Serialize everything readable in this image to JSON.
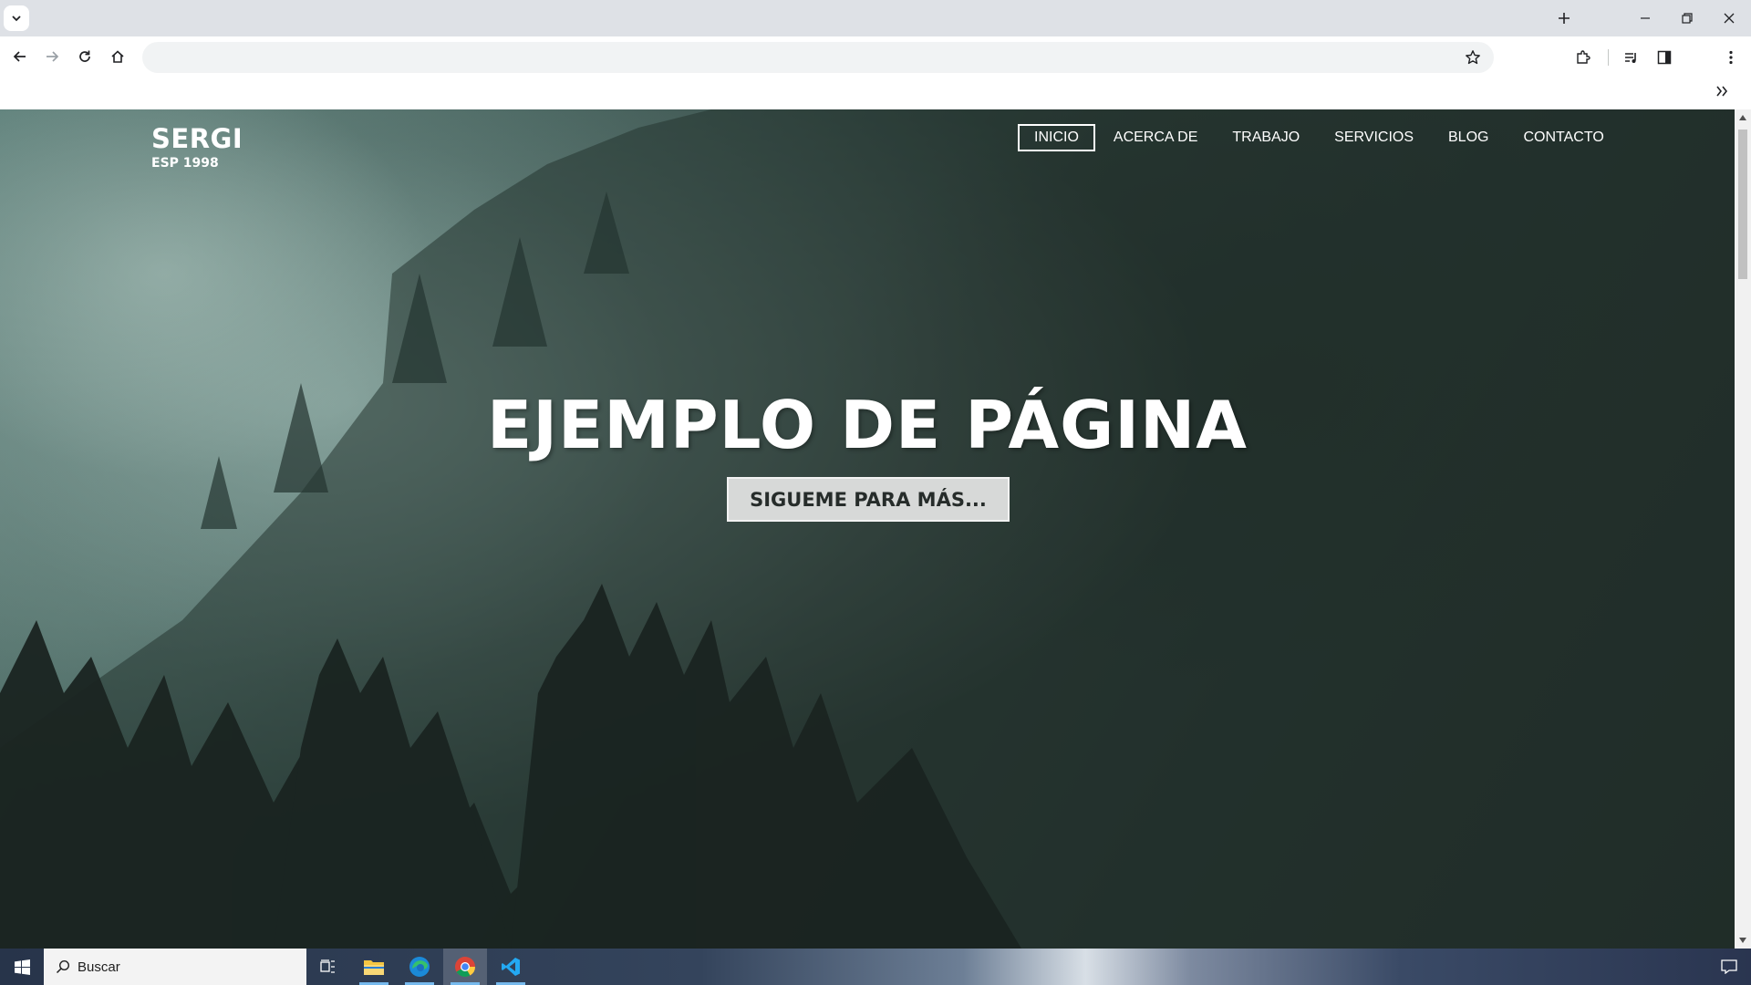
{
  "browser": {
    "address_value": "",
    "address_placeholder": ""
  },
  "site": {
    "brand_name": "SERGI",
    "brand_sub": "ESP 1998",
    "nav": [
      "INICIO",
      "ACERCA DE",
      "TRABAJO",
      "SERVICIOS",
      "BLOG",
      "CONTACTO"
    ],
    "active_nav": "INICIO",
    "hero_title": "EJEMPLO DE PÁGINA",
    "hero_button": "SIGUEME PARA MÁS..."
  },
  "taskbar": {
    "search_text": "Buscar",
    "apps": [
      "task-view",
      "file-explorer",
      "edge",
      "chrome",
      "vscode"
    ]
  },
  "colors": {
    "hero_dark": "#1f2926",
    "hero_fog": "#5c7e78",
    "button_bg": "#d7d9d8",
    "button_text": "#262c2a"
  }
}
